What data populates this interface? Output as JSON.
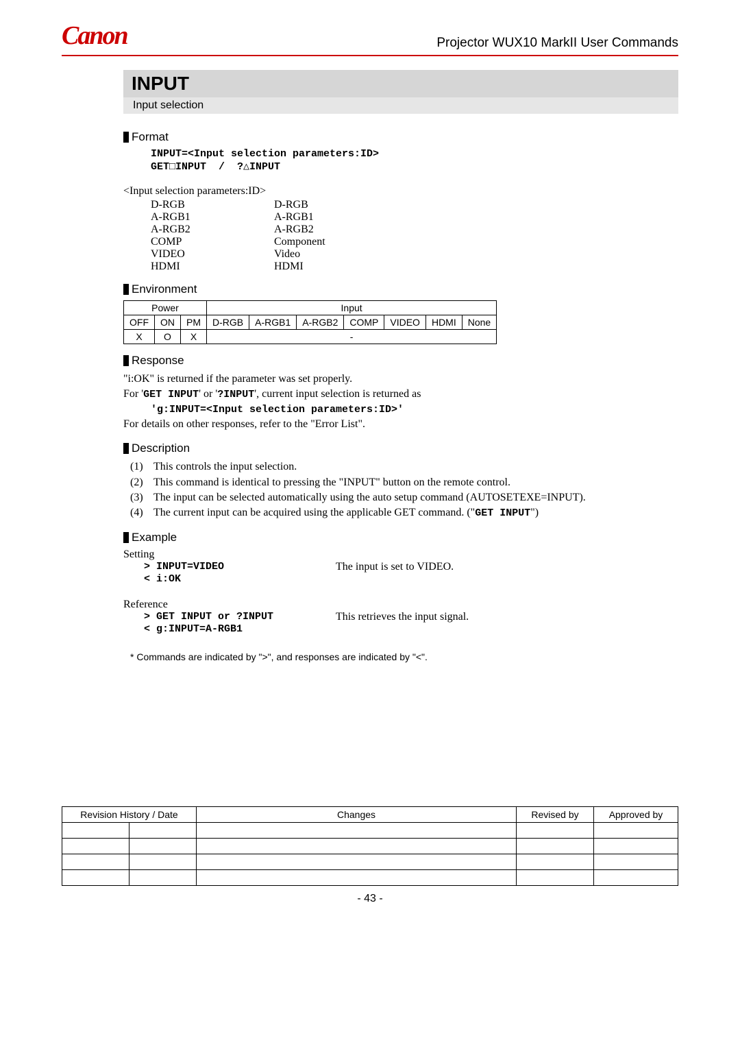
{
  "header": {
    "logo": "Canon",
    "doc_title": "Projector WUX10 MarkII User Commands"
  },
  "command": {
    "title": "INPUT",
    "subtitle": "Input selection"
  },
  "sections": {
    "format": {
      "heading": "Format",
      "line1": "INPUT=<Input selection parameters:ID>",
      "line2": "GET□INPUT  /  ?△INPUT",
      "param_title": "<Input selection parameters:ID>",
      "params": [
        {
          "id": "D-RGB",
          "desc": "D-RGB"
        },
        {
          "id": "A-RGB1",
          "desc": "A-RGB1"
        },
        {
          "id": "A-RGB2",
          "desc": "A-RGB2"
        },
        {
          "id": "COMP",
          "desc": "Component"
        },
        {
          "id": "VIDEO",
          "desc": "Video"
        },
        {
          "id": "HDMI",
          "desc": "HDMI"
        }
      ]
    },
    "environment": {
      "heading": "Environment",
      "group_power": "Power",
      "group_input": "Input",
      "cols": [
        "OFF",
        "ON",
        "PM",
        "D-RGB",
        "A-RGB1",
        "A-RGB2",
        "COMP",
        "VIDEO",
        "HDMI",
        "None"
      ],
      "row": [
        "X",
        "O",
        "X",
        "-"
      ],
      "dash_colspan": 7
    },
    "response": {
      "heading": "Response",
      "line1": "\"i:OK\" is returned if the parameter was set properly.",
      "line2a": "For '",
      "line2b": "' or '",
      "line2c": "', current input selection is returned as",
      "cmd1": "GET INPUT",
      "cmd2": "?INPUT",
      "code": "'g:INPUT=<Input selection parameters:ID>'",
      "line3": "For details on other responses, refer to the \"Error List\"."
    },
    "description": {
      "heading": "Description",
      "items": [
        "This controls the input selection.",
        "This command is identical to pressing the \"INPUT\" button on the remote control.",
        "The input can be selected automatically using the auto setup command (AUTOSETEXE=INPUT).",
        "The current input can be acquired using the applicable GET command. (\""
      ],
      "item4_cmd": "GET INPUT",
      "item4_tail": "\")"
    },
    "example": {
      "heading": "Example",
      "setting_label": "Setting",
      "setting_cmd": "> INPUT=VIDEO",
      "setting_desc": "The input is set to VIDEO.",
      "setting_resp": "< i:OK",
      "reference_label": "Reference",
      "ref_cmd": "> GET INPUT or ?INPUT",
      "ref_desc": "This retrieves the input signal.",
      "ref_resp": "< g:INPUT=A-RGB1",
      "footnote": "* Commands are indicated by \">\", and responses are indicated by \"<\"."
    }
  },
  "revision": {
    "headers": [
      "Revision History / Date",
      "Changes",
      "Revised by",
      "Approved by"
    ],
    "rows": 4
  },
  "page_num": "- 43 -"
}
